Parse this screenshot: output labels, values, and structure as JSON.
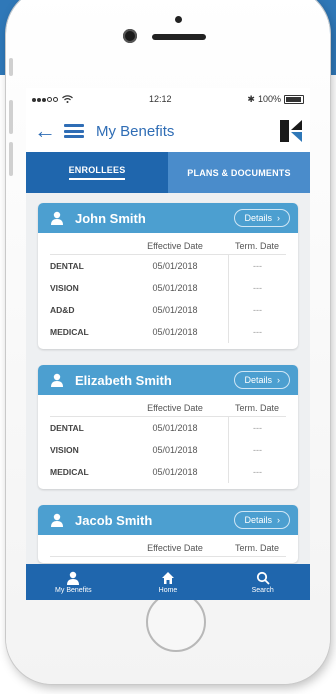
{
  "status_bar": {
    "time": "12:12",
    "battery": "100%",
    "bluetooth_icon": "bluetooth-icon",
    "wifi_icon": "wifi-icon"
  },
  "nav": {
    "title": "My Benefits",
    "back_icon": "back-arrow-icon",
    "menu_icon": "hamburger-menu-icon",
    "logo": "company-logo"
  },
  "tabs": [
    {
      "label": "ENROLLEES",
      "active": true
    },
    {
      "label": "PLANS & DOCUMENTS",
      "active": false
    }
  ],
  "table_headers": {
    "effective": "Effective Date",
    "term": "Term. Date"
  },
  "details_label": "Details",
  "enrollees": [
    {
      "name": "John Smith",
      "rows": [
        {
          "plan": "DENTAL",
          "effective": "05/01/2018",
          "term": "---"
        },
        {
          "plan": "VISION",
          "effective": "05/01/2018",
          "term": "---"
        },
        {
          "plan": "AD&D",
          "effective": "05/01/2018",
          "term": "---"
        },
        {
          "plan": "MEDICAL",
          "effective": "05/01/2018",
          "term": "---"
        }
      ]
    },
    {
      "name": "Elizabeth Smith",
      "rows": [
        {
          "plan": "DENTAL",
          "effective": "05/01/2018",
          "term": "---"
        },
        {
          "plan": "VISION",
          "effective": "05/01/2018",
          "term": "---"
        },
        {
          "plan": "MEDICAL",
          "effective": "05/01/2018",
          "term": "---"
        }
      ]
    },
    {
      "name": "Jacob Smith",
      "rows": []
    }
  ],
  "tab_bar": [
    {
      "label": "My Benefits",
      "icon": "person-icon"
    },
    {
      "label": "Home",
      "icon": "home-icon"
    },
    {
      "label": "Search",
      "icon": "search-icon"
    }
  ],
  "colors": {
    "primary": "#1f66ad",
    "card_header": "#4c9fd0",
    "tab_inactive": "#4a8ccb",
    "background_band": "#2f78b8"
  }
}
